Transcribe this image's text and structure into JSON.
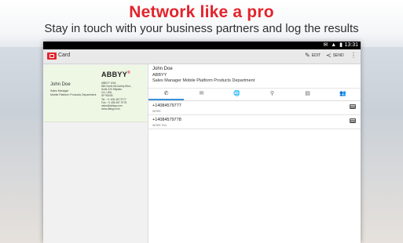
{
  "promo": {
    "headline": "Network like a pro",
    "subline": "Stay in touch with your business partners and log the results"
  },
  "statusbar": {
    "time": "13:31",
    "icons": "✉ ▲ ▮"
  },
  "actionbar": {
    "title": "Card",
    "edit_label": "EDIT",
    "send_label": "SEND",
    "edit_icon": "pencil-icon",
    "send_icon": "share-icon",
    "overflow_icon": "more-vert-icon"
  },
  "card": {
    "brand": "ABBYY",
    "brand_mark": "®",
    "name": "John Doe",
    "lines_left": [
      "Sales Manager",
      "Mobile Platform Products Department"
    ],
    "lines_right": [
      "ABBYY USA",
      "880 North McCarthy Blvd.,",
      "Suite 220 Milpitas",
      "CA, USA",
      "SP 95035",
      "Tel.:   +1 408 457 9777",
      "Fax:   +1 408 457 9778",
      "sales@abbyy.com",
      "www.abbyy.com"
    ]
  },
  "contact": {
    "name": "John Doe",
    "company": "ABBYY",
    "title": "Sales Manager Mobile Platform Products Department"
  },
  "tabs": [
    {
      "icon": "phone-icon",
      "glyph": "✆"
    },
    {
      "icon": "email-icon",
      "glyph": "✉"
    },
    {
      "icon": "web-icon",
      "glyph": "🌐"
    },
    {
      "icon": "location-icon",
      "glyph": "⚲"
    },
    {
      "icon": "notes-icon",
      "glyph": "▤"
    },
    {
      "icon": "people-icon",
      "glyph": "👥"
    }
  ],
  "phones": [
    {
      "number": "+14084579777",
      "type": "WORK"
    },
    {
      "number": "+14084579778",
      "type": "WORK FAX"
    }
  ],
  "colors": {
    "brand_red": "#e3232b",
    "tab_accent": "#3a8fd8",
    "card_bg": "#eef7e4"
  }
}
